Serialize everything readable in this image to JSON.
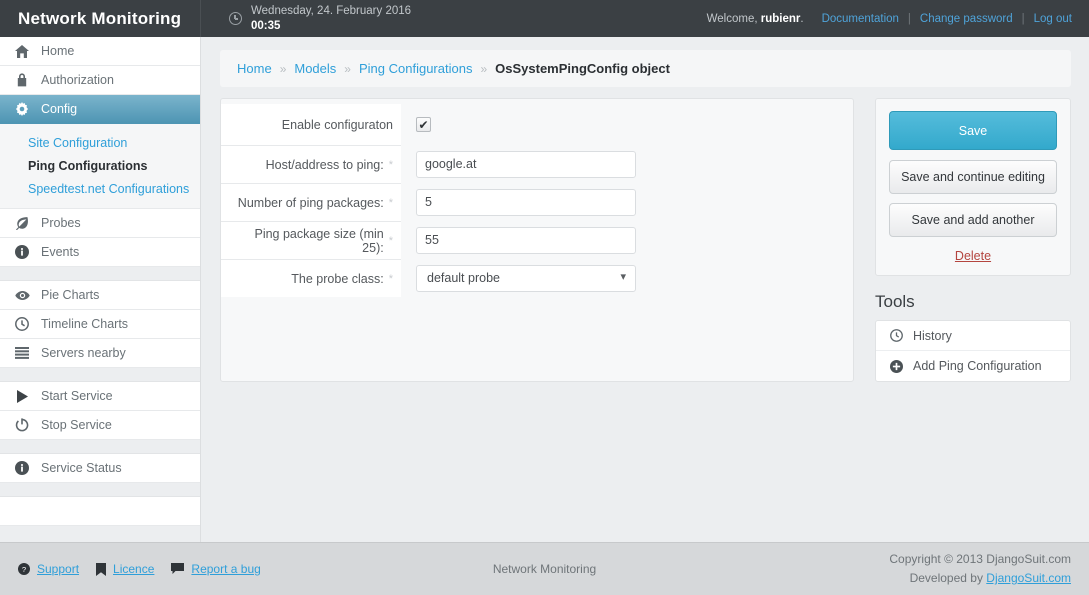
{
  "header": {
    "brand": "Network Monitoring",
    "clock_icon": "clock-icon",
    "date": "Wednesday, 24. February 2016",
    "time": "00:35",
    "welcome_prefix": "Welcome, ",
    "username": "rubienr",
    "welcome_suffix": ".",
    "links": [
      {
        "label": "Documentation"
      },
      {
        "label": "Change password"
      },
      {
        "label": "Log out"
      }
    ],
    "separator": "|"
  },
  "sidebar": {
    "items": [
      {
        "label": "Home",
        "icon": "home-icon"
      },
      {
        "label": "Authorization",
        "icon": "lock-icon"
      },
      {
        "label": "Config",
        "icon": "gear-icon",
        "active": true
      }
    ],
    "subitems": [
      {
        "label": "Site Configuration",
        "current": false
      },
      {
        "label": "Ping Configurations",
        "current": true
      },
      {
        "label": "Speedtest.net Configurations",
        "current": false
      }
    ],
    "items2": [
      {
        "label": "Probes",
        "icon": "leaf-icon"
      },
      {
        "label": "Events",
        "icon": "info-icon"
      }
    ],
    "items3": [
      {
        "label": "Pie Charts",
        "icon": "eye-icon"
      },
      {
        "label": "Timeline Charts",
        "icon": "clock-icon"
      },
      {
        "label": "Servers nearby",
        "icon": "list-icon"
      }
    ],
    "items4": [
      {
        "label": "Start Service",
        "icon": "play-icon"
      },
      {
        "label": "Stop Service",
        "icon": "power-icon"
      }
    ],
    "items5": [
      {
        "label": "Service Status",
        "icon": "info-icon"
      }
    ]
  },
  "breadcrumb": {
    "separator": "»",
    "crumbs": [
      {
        "label": "Home",
        "link": true
      },
      {
        "label": "Models",
        "link": true
      },
      {
        "label": "Ping Configurations",
        "link": true
      },
      {
        "label": "OsSystemPingConfig object",
        "link": false
      }
    ]
  },
  "form": {
    "rows": [
      {
        "label": "Enable configuraton",
        "required": false,
        "type": "checkbox",
        "checked": true,
        "check_glyph": "✔"
      },
      {
        "label": "Host/address to ping:",
        "required": true,
        "type": "text",
        "value": "google.at",
        "placeholder": ""
      },
      {
        "label": "Number of ping packages:",
        "required": true,
        "type": "text",
        "value": "5",
        "placeholder": ""
      },
      {
        "label": "Ping package size (min 25):",
        "required": true,
        "type": "text",
        "value": "55",
        "placeholder": ""
      },
      {
        "label": "The probe class:",
        "required": true,
        "type": "select",
        "value": "default probe",
        "options": [
          "default probe"
        ]
      }
    ],
    "required_mark": "*"
  },
  "actions": {
    "save": "Save",
    "save_continue": "Save and continue editing",
    "save_add_another": "Save and add another",
    "delete": "Delete"
  },
  "tools": {
    "title": "Tools",
    "items": [
      {
        "label": "History",
        "icon": "clock-icon"
      },
      {
        "label": "Add Ping Configuration",
        "icon": "plus-circle-icon"
      }
    ]
  },
  "footer": {
    "links": [
      {
        "label": "Support",
        "icon": "question-circle-icon"
      },
      {
        "label": "Licence",
        "icon": "bookmark-icon"
      },
      {
        "label": "Report a bug",
        "icon": "comment-icon"
      }
    ],
    "center": "Network Monitoring",
    "copyright": "Copyright © 2013 DjangoSuit.com",
    "developed_prefix": "Developed by ",
    "developed_link": "DjangoSuit.com"
  },
  "colors": {
    "header_bg": "#3b4044",
    "accent": "#2f9fd9",
    "active_nav": "#5d9fbb",
    "save_button": "#33a9cc",
    "delete_link": "#b4453f",
    "footer_bg": "#d6d8da"
  }
}
